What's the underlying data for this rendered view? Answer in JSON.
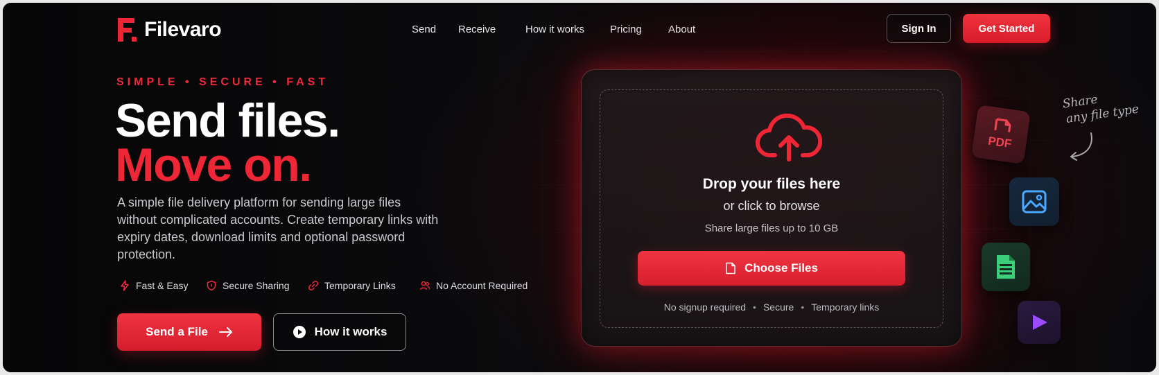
{
  "brand": {
    "name": "Filevaro",
    "accent": "#ee2635"
  },
  "nav": {
    "items": [
      {
        "label": "Send"
      },
      {
        "label": "Receive"
      },
      {
        "label": "How it works"
      },
      {
        "label": "Pricing"
      },
      {
        "label": "About"
      }
    ],
    "signin_label": "Sign In",
    "getstarted_label": "Get Started"
  },
  "hero": {
    "tagline": "SIMPLE  •  SECURE  •  FAST",
    "headline_line1": "Send files.",
    "headline_line2": "Move on.",
    "description": "A simple file delivery platform for sending large files without complicated accounts. Create temporary links with expiry dates, download limits and optional password protection.",
    "features": [
      {
        "label": "Fast & Easy",
        "icon": "bolt-icon"
      },
      {
        "label": "Secure Sharing",
        "icon": "shield-icon"
      },
      {
        "label": "Temporary Links",
        "icon": "link-icon"
      },
      {
        "label": "No Account Required",
        "icon": "users-icon"
      }
    ],
    "send_button": "Send a File",
    "how_button": "How it works"
  },
  "upload": {
    "title": "Drop your files here",
    "subtitle": "or click to browse",
    "limit": "Share large files up to 10 GB",
    "choose_button": "Choose Files",
    "footer": [
      "No signup required",
      "Secure",
      "Temporary links"
    ]
  },
  "side": {
    "note_line1": "Share",
    "note_line2": "any file type",
    "pdf_label": "PDF"
  }
}
